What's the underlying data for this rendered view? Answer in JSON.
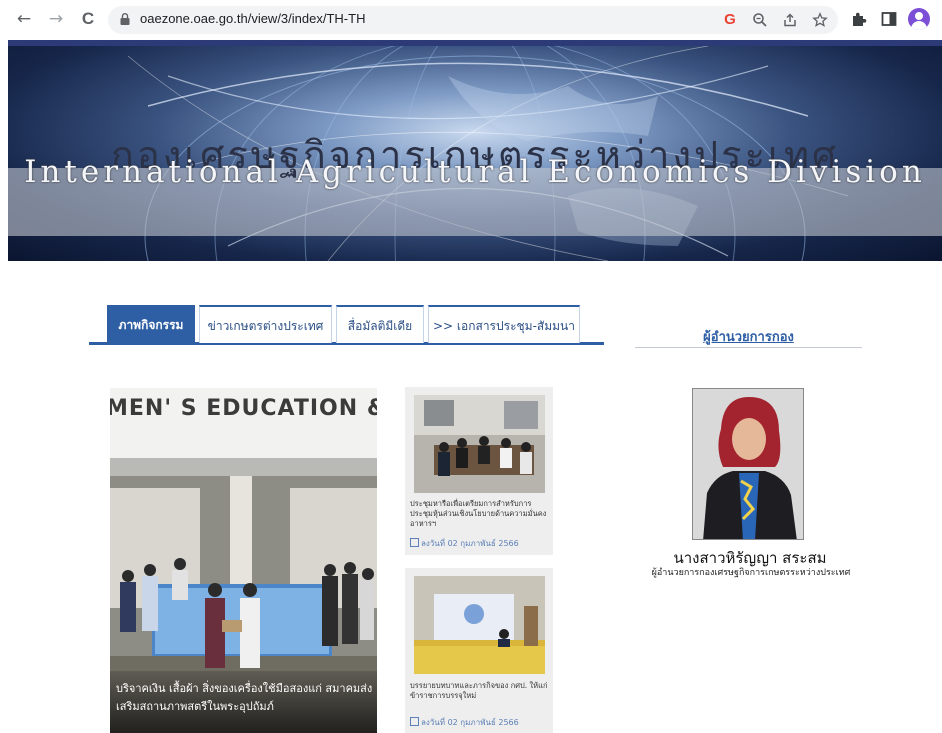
{
  "browser": {
    "url": "oaezone.oae.go.th/view/3/index/TH-TH",
    "back_icon": "←",
    "forward_icon": "→",
    "reload_icon": "C",
    "google_icon": "G"
  },
  "banner": {
    "title_th": "กองเศรษฐกิจการเกษตรระหว่างประเทศ",
    "title_en": "International Agricultural Economics Division"
  },
  "tabs": [
    {
      "label": "ภาพกิจกรรม",
      "active": true
    },
    {
      "label": "ข่าวเกษตรต่างประเทศ",
      "active": false
    },
    {
      "label": "สื่อมัลติมีเดีย",
      "active": false
    },
    {
      "label": ">> เอกสารประชุม-สัมมนา",
      "active": false
    }
  ],
  "featured": {
    "sign_text": "MEN' S EDUCATION & TR",
    "caption": "บริจาคเงิน เสื้อผ้า สิ่งของเครื่องใช้มือสองแก่ สมาคมส่งเสริมสถานภาพสตรีในพระอุปถัมภ์"
  },
  "news": [
    {
      "caption": "ประชุมหารือเพื่อเตรียมการสำหรับการประชุมหุ้นส่วนเชิงนโยบายด้านความมั่นคงอาหารฯ",
      "date": "ลงวันที่ 02 กุมภาพันธ์ 2566"
    },
    {
      "caption": "บรรยายบทบาทและภารกิจของ กศป. ให้แก่ข้าราชการบรรจุใหม่",
      "date": "ลงวันที่ 02 กุมภาพันธ์ 2566"
    }
  ],
  "director": {
    "heading": "ผู้อำนวยการกอง",
    "name": "นางสาวหิรัญญา สระสม",
    "position": "ผู้อำนวยการกองเศรษฐกิจการเกษตรระหว่างประเทศ"
  },
  "colors": {
    "accent": "#2e5fa5",
    "banner_bar": "#2d3a78",
    "date_text": "#5b7fb6"
  }
}
